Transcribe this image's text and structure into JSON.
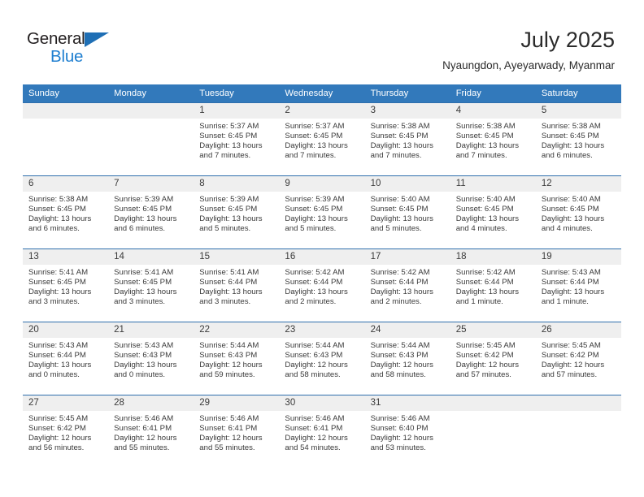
{
  "brand": {
    "name_part1": "General",
    "name_part2": "Blue",
    "accent_color": "#1f7fd0",
    "triangle_color": "#1f6fb5"
  },
  "header": {
    "title": "July 2025",
    "subtitle": "Nyaungdon, Ayeyarwady, Myanmar"
  },
  "calendar": {
    "header_bg": "#3279bb",
    "row_border": "#2f6fad",
    "daynum_bg": "#efefef",
    "weekday_labels": [
      "Sunday",
      "Monday",
      "Tuesday",
      "Wednesday",
      "Thursday",
      "Friday",
      "Saturday"
    ],
    "weeks": [
      [
        {
          "day": "",
          "sunrise": "",
          "sunset": "",
          "daylight": ""
        },
        {
          "day": "",
          "sunrise": "",
          "sunset": "",
          "daylight": ""
        },
        {
          "day": "1",
          "sunrise": "Sunrise: 5:37 AM",
          "sunset": "Sunset: 6:45 PM",
          "daylight": "Daylight: 13 hours and 7 minutes."
        },
        {
          "day": "2",
          "sunrise": "Sunrise: 5:37 AM",
          "sunset": "Sunset: 6:45 PM",
          "daylight": "Daylight: 13 hours and 7 minutes."
        },
        {
          "day": "3",
          "sunrise": "Sunrise: 5:38 AM",
          "sunset": "Sunset: 6:45 PM",
          "daylight": "Daylight: 13 hours and 7 minutes."
        },
        {
          "day": "4",
          "sunrise": "Sunrise: 5:38 AM",
          "sunset": "Sunset: 6:45 PM",
          "daylight": "Daylight: 13 hours and 7 minutes."
        },
        {
          "day": "5",
          "sunrise": "Sunrise: 5:38 AM",
          "sunset": "Sunset: 6:45 PM",
          "daylight": "Daylight: 13 hours and 6 minutes."
        }
      ],
      [
        {
          "day": "6",
          "sunrise": "Sunrise: 5:38 AM",
          "sunset": "Sunset: 6:45 PM",
          "daylight": "Daylight: 13 hours and 6 minutes."
        },
        {
          "day": "7",
          "sunrise": "Sunrise: 5:39 AM",
          "sunset": "Sunset: 6:45 PM",
          "daylight": "Daylight: 13 hours and 6 minutes."
        },
        {
          "day": "8",
          "sunrise": "Sunrise: 5:39 AM",
          "sunset": "Sunset: 6:45 PM",
          "daylight": "Daylight: 13 hours and 5 minutes."
        },
        {
          "day": "9",
          "sunrise": "Sunrise: 5:39 AM",
          "sunset": "Sunset: 6:45 PM",
          "daylight": "Daylight: 13 hours and 5 minutes."
        },
        {
          "day": "10",
          "sunrise": "Sunrise: 5:40 AM",
          "sunset": "Sunset: 6:45 PM",
          "daylight": "Daylight: 13 hours and 5 minutes."
        },
        {
          "day": "11",
          "sunrise": "Sunrise: 5:40 AM",
          "sunset": "Sunset: 6:45 PM",
          "daylight": "Daylight: 13 hours and 4 minutes."
        },
        {
          "day": "12",
          "sunrise": "Sunrise: 5:40 AM",
          "sunset": "Sunset: 6:45 PM",
          "daylight": "Daylight: 13 hours and 4 minutes."
        }
      ],
      [
        {
          "day": "13",
          "sunrise": "Sunrise: 5:41 AM",
          "sunset": "Sunset: 6:45 PM",
          "daylight": "Daylight: 13 hours and 3 minutes."
        },
        {
          "day": "14",
          "sunrise": "Sunrise: 5:41 AM",
          "sunset": "Sunset: 6:45 PM",
          "daylight": "Daylight: 13 hours and 3 minutes."
        },
        {
          "day": "15",
          "sunrise": "Sunrise: 5:41 AM",
          "sunset": "Sunset: 6:44 PM",
          "daylight": "Daylight: 13 hours and 3 minutes."
        },
        {
          "day": "16",
          "sunrise": "Sunrise: 5:42 AM",
          "sunset": "Sunset: 6:44 PM",
          "daylight": "Daylight: 13 hours and 2 minutes."
        },
        {
          "day": "17",
          "sunrise": "Sunrise: 5:42 AM",
          "sunset": "Sunset: 6:44 PM",
          "daylight": "Daylight: 13 hours and 2 minutes."
        },
        {
          "day": "18",
          "sunrise": "Sunrise: 5:42 AM",
          "sunset": "Sunset: 6:44 PM",
          "daylight": "Daylight: 13 hours and 1 minute."
        },
        {
          "day": "19",
          "sunrise": "Sunrise: 5:43 AM",
          "sunset": "Sunset: 6:44 PM",
          "daylight": "Daylight: 13 hours and 1 minute."
        }
      ],
      [
        {
          "day": "20",
          "sunrise": "Sunrise: 5:43 AM",
          "sunset": "Sunset: 6:44 PM",
          "daylight": "Daylight: 13 hours and 0 minutes."
        },
        {
          "day": "21",
          "sunrise": "Sunrise: 5:43 AM",
          "sunset": "Sunset: 6:43 PM",
          "daylight": "Daylight: 13 hours and 0 minutes."
        },
        {
          "day": "22",
          "sunrise": "Sunrise: 5:44 AM",
          "sunset": "Sunset: 6:43 PM",
          "daylight": "Daylight: 12 hours and 59 minutes."
        },
        {
          "day": "23",
          "sunrise": "Sunrise: 5:44 AM",
          "sunset": "Sunset: 6:43 PM",
          "daylight": "Daylight: 12 hours and 58 minutes."
        },
        {
          "day": "24",
          "sunrise": "Sunrise: 5:44 AM",
          "sunset": "Sunset: 6:43 PM",
          "daylight": "Daylight: 12 hours and 58 minutes."
        },
        {
          "day": "25",
          "sunrise": "Sunrise: 5:45 AM",
          "sunset": "Sunset: 6:42 PM",
          "daylight": "Daylight: 12 hours and 57 minutes."
        },
        {
          "day": "26",
          "sunrise": "Sunrise: 5:45 AM",
          "sunset": "Sunset: 6:42 PM",
          "daylight": "Daylight: 12 hours and 57 minutes."
        }
      ],
      [
        {
          "day": "27",
          "sunrise": "Sunrise: 5:45 AM",
          "sunset": "Sunset: 6:42 PM",
          "daylight": "Daylight: 12 hours and 56 minutes."
        },
        {
          "day": "28",
          "sunrise": "Sunrise: 5:46 AM",
          "sunset": "Sunset: 6:41 PM",
          "daylight": "Daylight: 12 hours and 55 minutes."
        },
        {
          "day": "29",
          "sunrise": "Sunrise: 5:46 AM",
          "sunset": "Sunset: 6:41 PM",
          "daylight": "Daylight: 12 hours and 55 minutes."
        },
        {
          "day": "30",
          "sunrise": "Sunrise: 5:46 AM",
          "sunset": "Sunset: 6:41 PM",
          "daylight": "Daylight: 12 hours and 54 minutes."
        },
        {
          "day": "31",
          "sunrise": "Sunrise: 5:46 AM",
          "sunset": "Sunset: 6:40 PM",
          "daylight": "Daylight: 12 hours and 53 minutes."
        },
        {
          "day": "",
          "sunrise": "",
          "sunset": "",
          "daylight": ""
        },
        {
          "day": "",
          "sunrise": "",
          "sunset": "",
          "daylight": ""
        }
      ]
    ]
  }
}
